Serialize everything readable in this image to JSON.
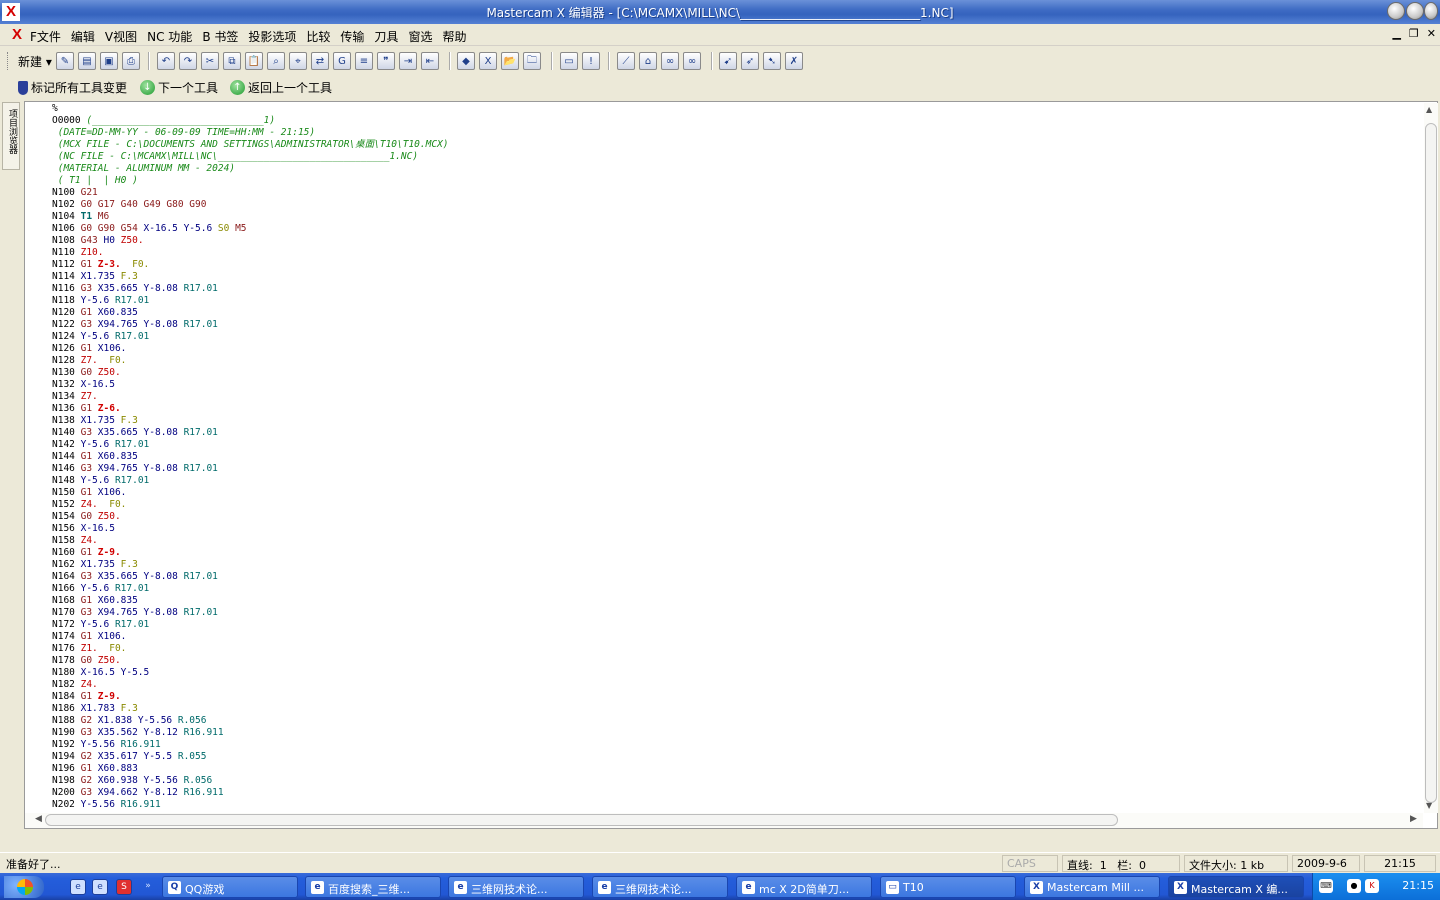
{
  "window": {
    "title": "Mastercam X 编辑器 - [C:\\MCAMX\\MILL\\NC\\______________________________1.NC]"
  },
  "menu": {
    "items": [
      "F文件",
      "编辑",
      "V视图",
      "NC 功能",
      "B 书签",
      "投影选项",
      "比较",
      "传输",
      "刀具",
      "窗选",
      "帮助"
    ]
  },
  "toolbar": {
    "new_label": "新建"
  },
  "toolbar2": {
    "mark_all": "标记所有工具变更",
    "next_tool": "下一个工具",
    "prev_tool": "返回上一个工具"
  },
  "sidetab": {
    "label": "项目浏览器"
  },
  "code": [
    [
      [
        "d",
        "%"
      ]
    ],
    [
      [
        "d",
        "O0000 "
      ],
      [
        "cmt",
        "(______________________________1)"
      ]
    ],
    [
      [
        "cmt",
        " (DATE=DD-MM-YY - 06-09-09 TIME=HH:MM - 21:15)"
      ]
    ],
    [
      [
        "cmt",
        " (MCX FILE - C:\\DOCUMENTS AND SETTINGS\\ADMINISTRATOR\\桌面\\T10\\T10.MCX)"
      ]
    ],
    [
      [
        "cmt",
        " (NC FILE - C:\\MCAMX\\MILL\\NC\\______________________________1.NC)"
      ]
    ],
    [
      [
        "cmt",
        " (MATERIAL - ALUMINUM MM - 2024)"
      ]
    ],
    [
      [
        "cmt",
        " ( T1 |  | H0 )"
      ]
    ],
    [
      [
        "n",
        "N100 "
      ],
      [
        "g",
        "G21"
      ]
    ],
    [
      [
        "n",
        "N102 "
      ],
      [
        "g",
        "G0 G17 G40 G49 G80 G90"
      ]
    ],
    [
      [
        "n",
        "N104 "
      ],
      [
        "t",
        "T1"
      ],
      [
        "m",
        " M6"
      ]
    ],
    [
      [
        "n",
        "N106 "
      ],
      [
        "g",
        "G0 G90 G54 "
      ],
      [
        "x",
        "X-16.5 Y-5.6 "
      ],
      [
        "s",
        "S0 "
      ],
      [
        "m",
        "M5"
      ]
    ],
    [
      [
        "n",
        "N108 "
      ],
      [
        "g",
        "G43 "
      ],
      [
        "x",
        "H0 "
      ],
      [
        "z",
        "Z50."
      ]
    ],
    [
      [
        "n",
        "N110 "
      ],
      [
        "z",
        "Z10."
      ]
    ],
    [
      [
        "n",
        "N112 "
      ],
      [
        "g",
        "G1 "
      ],
      [
        "zb",
        "Z-3."
      ],
      [
        "f",
        "  F0."
      ]
    ],
    [
      [
        "n",
        "N114 "
      ],
      [
        "x",
        "X1.735 "
      ],
      [
        "f",
        "F.3"
      ]
    ],
    [
      [
        "n",
        "N116 "
      ],
      [
        "g",
        "G3 "
      ],
      [
        "x",
        "X35.665 Y-8.08 "
      ],
      [
        "r",
        "R17.01"
      ]
    ],
    [
      [
        "n",
        "N118 "
      ],
      [
        "x",
        "Y-5.6 "
      ],
      [
        "r",
        "R17.01"
      ]
    ],
    [
      [
        "n",
        "N120 "
      ],
      [
        "g",
        "G1 "
      ],
      [
        "x",
        "X60.835"
      ]
    ],
    [
      [
        "n",
        "N122 "
      ],
      [
        "g",
        "G3 "
      ],
      [
        "x",
        "X94.765 Y-8.08 "
      ],
      [
        "r",
        "R17.01"
      ]
    ],
    [
      [
        "n",
        "N124 "
      ],
      [
        "x",
        "Y-5.6 "
      ],
      [
        "r",
        "R17.01"
      ]
    ],
    [
      [
        "n",
        "N126 "
      ],
      [
        "g",
        "G1 "
      ],
      [
        "x",
        "X106."
      ]
    ],
    [
      [
        "n",
        "N128 "
      ],
      [
        "z",
        "Z7. "
      ],
      [
        "f",
        " F0."
      ]
    ],
    [
      [
        "n",
        "N130 "
      ],
      [
        "g",
        "G0 "
      ],
      [
        "z",
        "Z50."
      ]
    ],
    [
      [
        "n",
        "N132 "
      ],
      [
        "x",
        "X-16.5"
      ]
    ],
    [
      [
        "n",
        "N134 "
      ],
      [
        "z",
        "Z7."
      ]
    ],
    [
      [
        "n",
        "N136 "
      ],
      [
        "g",
        "G1 "
      ],
      [
        "zb",
        "Z-6."
      ]
    ],
    [
      [
        "n",
        "N138 "
      ],
      [
        "x",
        "X1.735 "
      ],
      [
        "f",
        "F.3"
      ]
    ],
    [
      [
        "n",
        "N140 "
      ],
      [
        "g",
        "G3 "
      ],
      [
        "x",
        "X35.665 Y-8.08 "
      ],
      [
        "r",
        "R17.01"
      ]
    ],
    [
      [
        "n",
        "N142 "
      ],
      [
        "x",
        "Y-5.6 "
      ],
      [
        "r",
        "R17.01"
      ]
    ],
    [
      [
        "n",
        "N144 "
      ],
      [
        "g",
        "G1 "
      ],
      [
        "x",
        "X60.835"
      ]
    ],
    [
      [
        "n",
        "N146 "
      ],
      [
        "g",
        "G3 "
      ],
      [
        "x",
        "X94.765 Y-8.08 "
      ],
      [
        "r",
        "R17.01"
      ]
    ],
    [
      [
        "n",
        "N148 "
      ],
      [
        "x",
        "Y-5.6 "
      ],
      [
        "r",
        "R17.01"
      ]
    ],
    [
      [
        "n",
        "N150 "
      ],
      [
        "g",
        "G1 "
      ],
      [
        "x",
        "X106."
      ]
    ],
    [
      [
        "n",
        "N152 "
      ],
      [
        "z",
        "Z4. "
      ],
      [
        "f",
        " F0."
      ]
    ],
    [
      [
        "n",
        "N154 "
      ],
      [
        "g",
        "G0 "
      ],
      [
        "z",
        "Z50."
      ]
    ],
    [
      [
        "n",
        "N156 "
      ],
      [
        "x",
        "X-16.5"
      ]
    ],
    [
      [
        "n",
        "N158 "
      ],
      [
        "z",
        "Z4."
      ]
    ],
    [
      [
        "n",
        "N160 "
      ],
      [
        "g",
        "G1 "
      ],
      [
        "zb",
        "Z-9."
      ]
    ],
    [
      [
        "n",
        "N162 "
      ],
      [
        "x",
        "X1.735 "
      ],
      [
        "f",
        "F.3"
      ]
    ],
    [
      [
        "n",
        "N164 "
      ],
      [
        "g",
        "G3 "
      ],
      [
        "x",
        "X35.665 Y-8.08 "
      ],
      [
        "r",
        "R17.01"
      ]
    ],
    [
      [
        "n",
        "N166 "
      ],
      [
        "x",
        "Y-5.6 "
      ],
      [
        "r",
        "R17.01"
      ]
    ],
    [
      [
        "n",
        "N168 "
      ],
      [
        "g",
        "G1 "
      ],
      [
        "x",
        "X60.835"
      ]
    ],
    [
      [
        "n",
        "N170 "
      ],
      [
        "g",
        "G3 "
      ],
      [
        "x",
        "X94.765 Y-8.08 "
      ],
      [
        "r",
        "R17.01"
      ]
    ],
    [
      [
        "n",
        "N172 "
      ],
      [
        "x",
        "Y-5.6 "
      ],
      [
        "r",
        "R17.01"
      ]
    ],
    [
      [
        "n",
        "N174 "
      ],
      [
        "g",
        "G1 "
      ],
      [
        "x",
        "X106."
      ]
    ],
    [
      [
        "n",
        "N176 "
      ],
      [
        "z",
        "Z1. "
      ],
      [
        "f",
        " F0."
      ]
    ],
    [
      [
        "n",
        "N178 "
      ],
      [
        "g",
        "G0 "
      ],
      [
        "z",
        "Z50."
      ]
    ],
    [
      [
        "n",
        "N180 "
      ],
      [
        "x",
        "X-16.5 Y-5.5"
      ]
    ],
    [
      [
        "n",
        "N182 "
      ],
      [
        "z",
        "Z4."
      ]
    ],
    [
      [
        "n",
        "N184 "
      ],
      [
        "g",
        "G1 "
      ],
      [
        "zb",
        "Z-9."
      ]
    ],
    [
      [
        "n",
        "N186 "
      ],
      [
        "x",
        "X1.783 "
      ],
      [
        "f",
        "F.3"
      ]
    ],
    [
      [
        "n",
        "N188 "
      ],
      [
        "g",
        "G2 "
      ],
      [
        "x",
        "X1.838 Y-5.56 "
      ],
      [
        "r",
        "R.056"
      ]
    ],
    [
      [
        "n",
        "N190 "
      ],
      [
        "g",
        "G3 "
      ],
      [
        "x",
        "X35.562 Y-8.12 "
      ],
      [
        "r",
        "R16.911"
      ]
    ],
    [
      [
        "n",
        "N192 "
      ],
      [
        "x",
        "Y-5.56 "
      ],
      [
        "r",
        "R16.911"
      ]
    ],
    [
      [
        "n",
        "N194 "
      ],
      [
        "g",
        "G2 "
      ],
      [
        "x",
        "X35.617 Y-5.5 "
      ],
      [
        "r",
        "R.055"
      ]
    ],
    [
      [
        "n",
        "N196 "
      ],
      [
        "g",
        "G1 "
      ],
      [
        "x",
        "X60.883"
      ]
    ],
    [
      [
        "n",
        "N198 "
      ],
      [
        "g",
        "G2 "
      ],
      [
        "x",
        "X60.938 Y-5.56 "
      ],
      [
        "r",
        "R.056"
      ]
    ],
    [
      [
        "n",
        "N200 "
      ],
      [
        "g",
        "G3 "
      ],
      [
        "x",
        "X94.662 Y-8.12 "
      ],
      [
        "r",
        "R16.911"
      ]
    ],
    [
      [
        "n",
        "N202 "
      ],
      [
        "x",
        "Y-5.56 "
      ],
      [
        "r",
        "R16.911"
      ]
    ]
  ],
  "status": {
    "text": "准备好了...",
    "caps": "CAPS",
    "line_label": "直线:",
    "line_value": "1",
    "col_label": "栏:",
    "col_value": "0",
    "size_label": "文件大小:",
    "size_value": "1 kb",
    "date": "2009-9-6",
    "time": "21:15"
  },
  "taskbar": {
    "tasks": [
      {
        "label": "QQ游戏",
        "icon": "Q"
      },
      {
        "label": "百度搜索_三维...",
        "icon": "e"
      },
      {
        "label": "三维网技术论...",
        "icon": "e"
      },
      {
        "label": "三维网技术论...",
        "icon": "e"
      },
      {
        "label": "mc X 2D简单刀...",
        "icon": "e"
      },
      {
        "label": "T10",
        "icon": "▭"
      },
      {
        "label": "Mastercam Mill ...",
        "icon": "X"
      },
      {
        "label": "Mastercam X 编...",
        "icon": "X"
      }
    ],
    "clock": "21:15"
  }
}
